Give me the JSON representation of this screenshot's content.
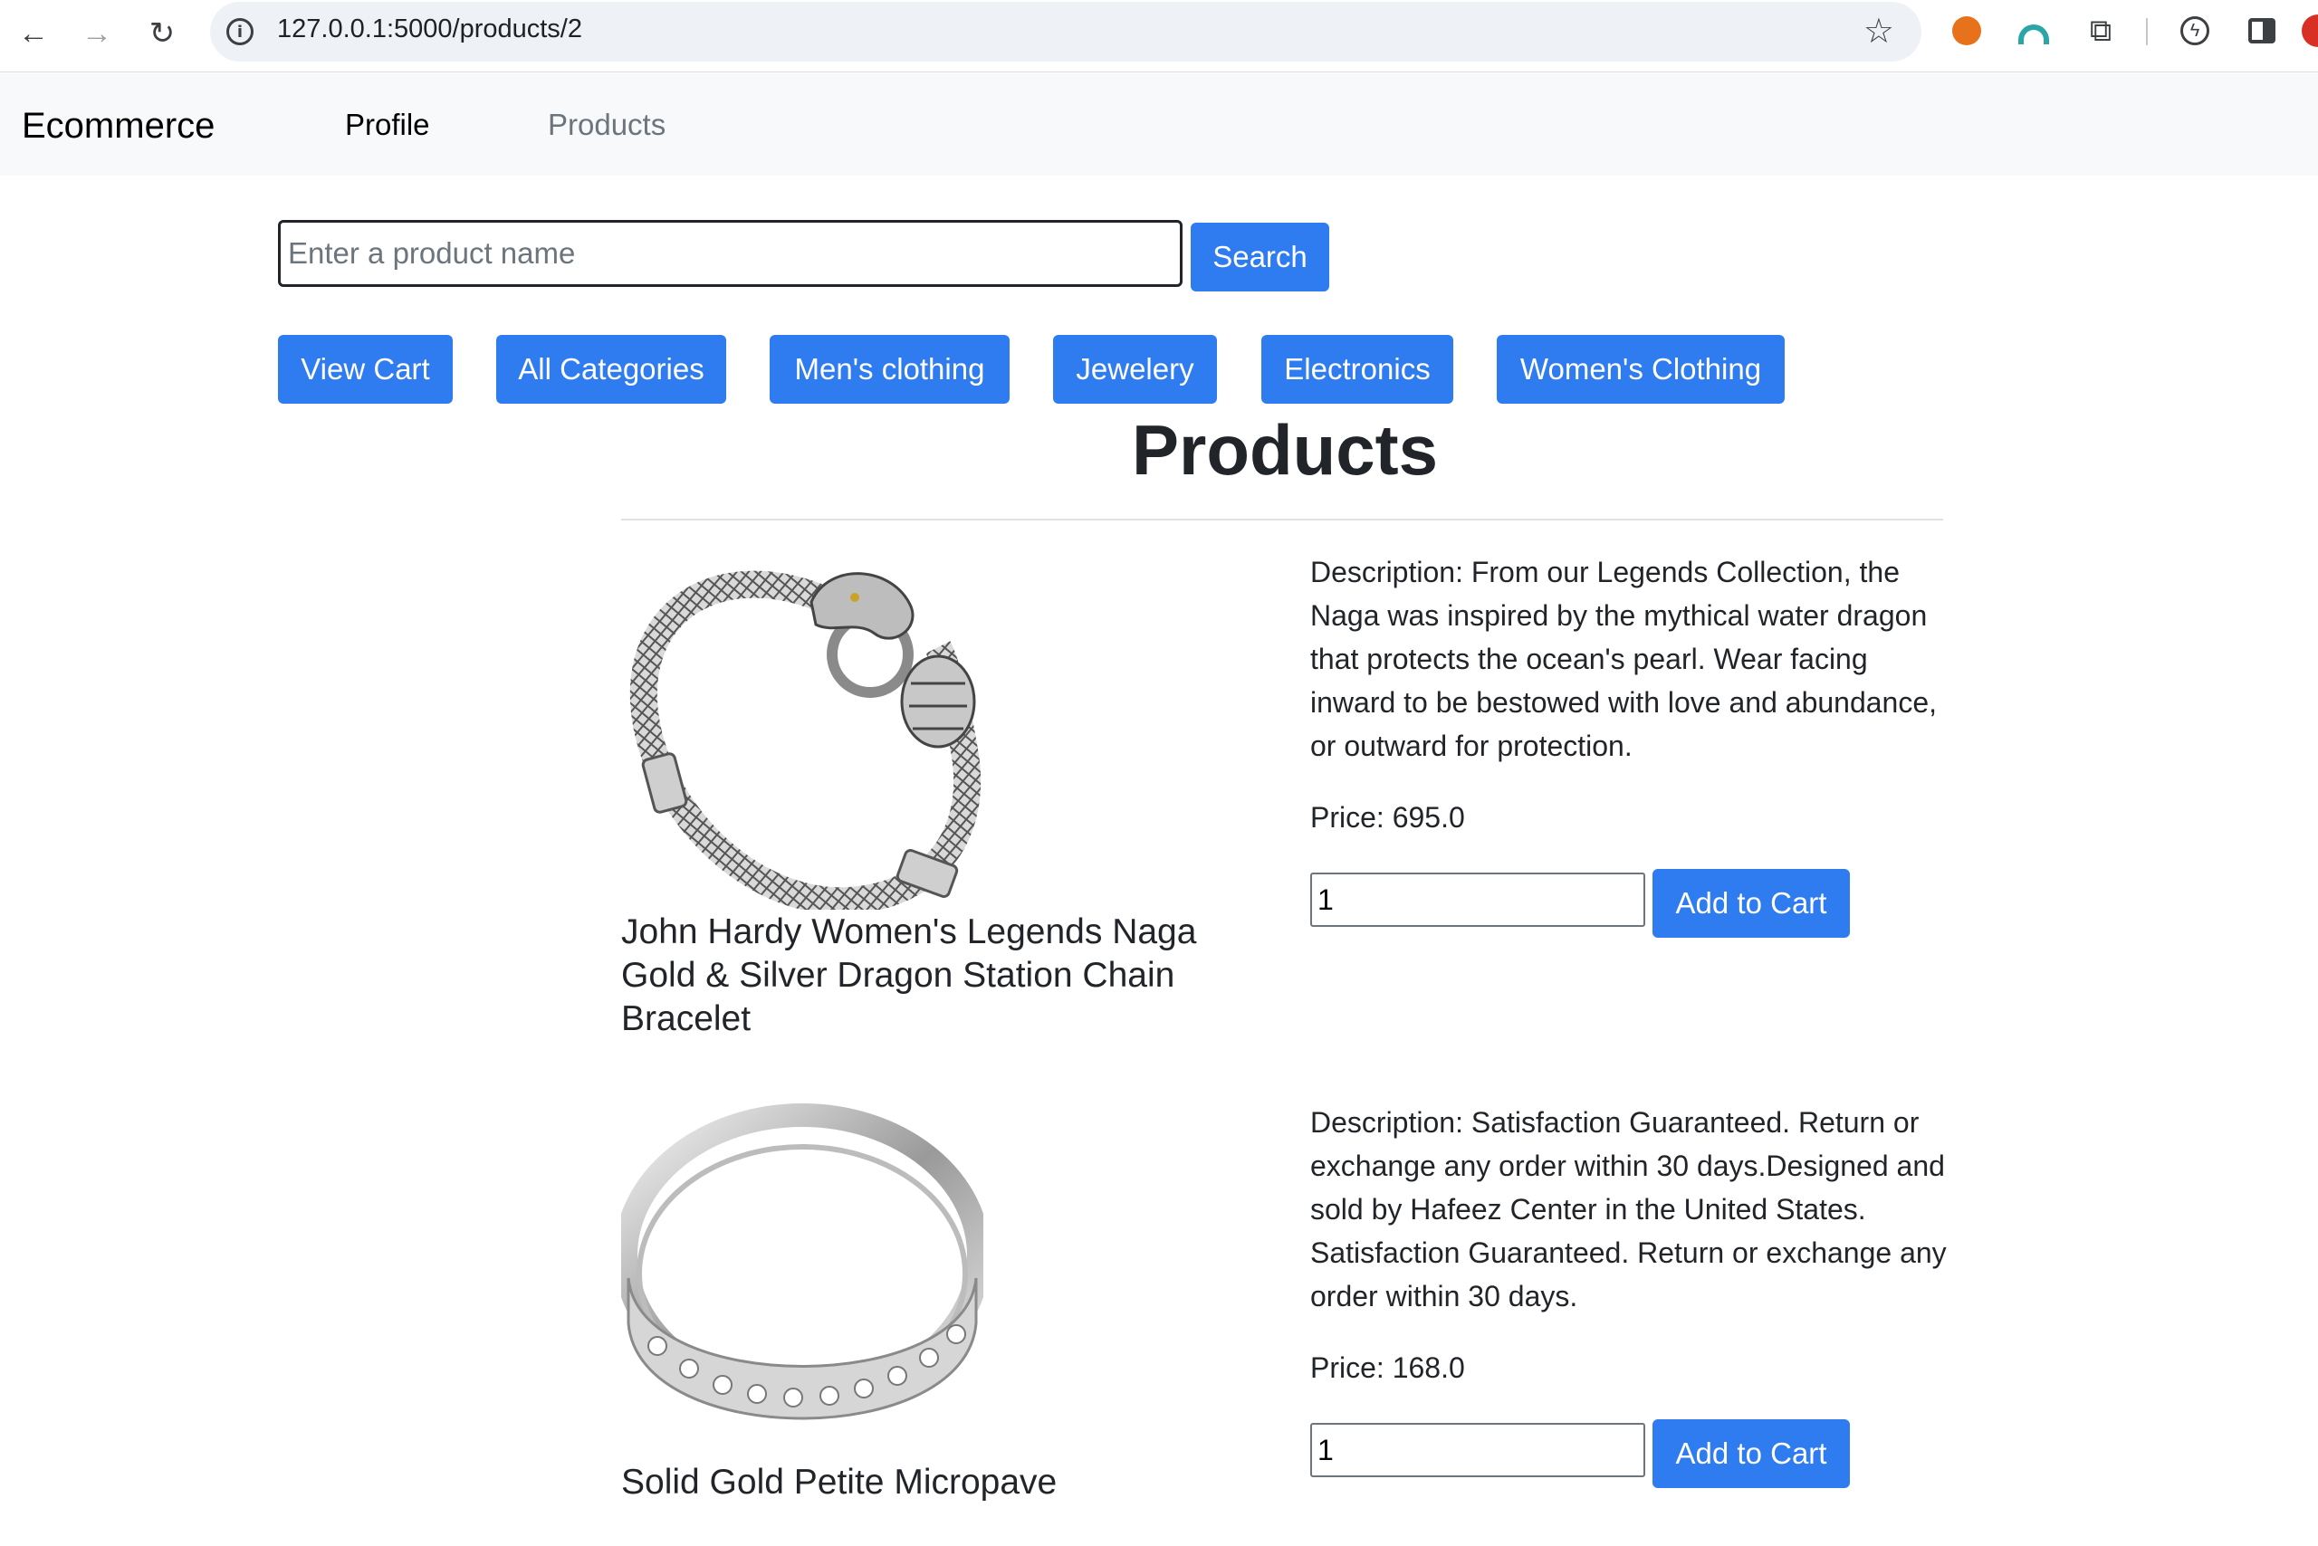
{
  "browser": {
    "url": "127.0.0.1:5000/products/2",
    "back_icon": "←",
    "forward_icon": "→",
    "reload_icon": "↻",
    "info_icon": "i",
    "star_icon": "☆",
    "puzzle_icon": "⧉",
    "bolt_icon": "ϟ"
  },
  "navbar": {
    "brand": "Ecommerce",
    "links": [
      {
        "label": "Profile"
      },
      {
        "label": "Products"
      }
    ]
  },
  "search": {
    "placeholder": "Enter a product name",
    "button": "Search"
  },
  "categories": [
    {
      "label": "View Cart"
    },
    {
      "label": "All Categories"
    },
    {
      "label": "Men's clothing"
    },
    {
      "label": "Jewelery"
    },
    {
      "label": "Electronics"
    },
    {
      "label": "Women's Clothing"
    }
  ],
  "page_title": "Products",
  "products": [
    {
      "name": "John Hardy Women's Legends Naga Gold & Silver Dragon Station Chain Bracelet",
      "description": "Description: From our Legends Collection, the Naga was inspired by the mythical water dragon that protects the ocean's pearl. Wear facing inward to be bestowed with love and abundance, or outward for protection.",
      "price": "Price: 695.0",
      "quantity": "1",
      "add_button": "Add to Cart"
    },
    {
      "name": "Solid Gold Petite Micropave",
      "description": "Description: Satisfaction Guaranteed. Return or exchange any order within 30 days.Designed and sold by Hafeez Center in the United States. Satisfaction Guaranteed. Return or exchange any order within 30 days.",
      "price": "Price: 168.0",
      "quantity": "1",
      "add_button": "Add to Cart"
    }
  ]
}
